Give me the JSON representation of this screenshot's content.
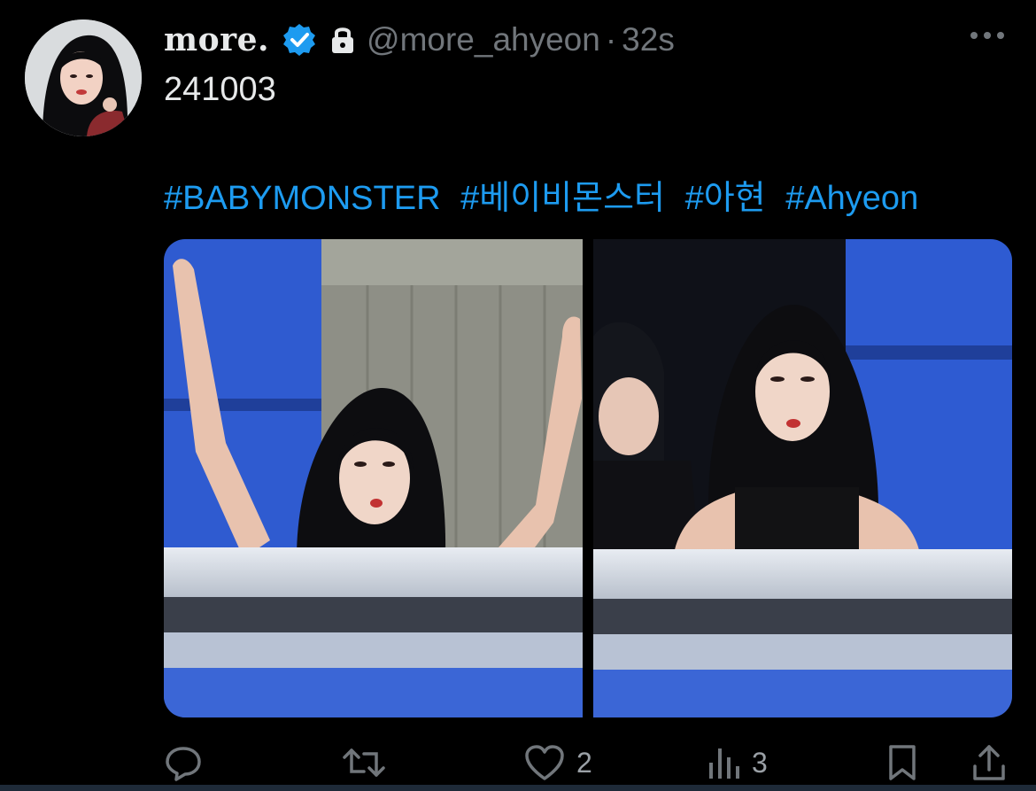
{
  "tweet": {
    "display_name": "more.",
    "handle": "@more_ahyeon",
    "separator": "·",
    "time": "32s",
    "verified": true,
    "protected": true,
    "text": "241003",
    "hashtags": [
      "#BABYMONSTER",
      "#베이비몬스터",
      "#아현",
      "#Ahyeon"
    ],
    "media_count": 2
  },
  "actions": {
    "reply_count": "",
    "retweet_count": "",
    "like_count": "2",
    "views_count": "3"
  },
  "icons": {
    "verified": "verified-badge-icon",
    "protected": "lock-icon",
    "more": "more-horizontal-icon",
    "reply": "reply-icon",
    "retweet": "retweet-icon",
    "like": "heart-icon",
    "views": "views-chart-icon",
    "bookmark": "bookmark-icon",
    "share": "share-icon"
  },
  "colors": {
    "background": "#000000",
    "primary_text": "#e7e9ea",
    "secondary_text": "#71767b",
    "hashtag": "#1d9bf0",
    "verified": "#1d9bf0"
  }
}
